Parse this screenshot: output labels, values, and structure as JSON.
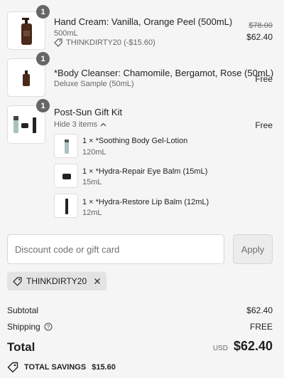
{
  "items": [
    {
      "quantity": "1",
      "name": "Hand Cream: Vanilla, Orange Peel (500mL)",
      "variant": "500mL",
      "discount_code": "THINKDIRTY20 (-$15.60)",
      "original_price": "$78.00",
      "price": "$62.40"
    },
    {
      "quantity": "1",
      "name": "*Body Cleanser: Chamomile, Bergamot, Rose (50mL)",
      "variant": "Deluxe Sample (50mL)",
      "price": "Free"
    },
    {
      "quantity": "1",
      "name": "Post-Sun Gift Kit",
      "toggle_label": "Hide 3 items",
      "price": "Free",
      "components": [
        {
          "name": "1 × *Soothing Body Gel-Lotion",
          "size": "120mL"
        },
        {
          "name": "1 × *Hydra-Repair Eye Balm (15mL)",
          "size": "15mL"
        },
        {
          "name": "1 × *Hydra-Restore Lip Balm (12mL)",
          "size": "12mL"
        }
      ]
    }
  ],
  "discount": {
    "placeholder": "Discount code or gift card",
    "apply_label": "Apply",
    "applied_code": "THINKDIRTY20"
  },
  "summary": {
    "subtotal_label": "Subtotal",
    "subtotal_value": "$62.40",
    "shipping_label": "Shipping",
    "shipping_value": "FREE",
    "total_label": "Total",
    "currency": "USD",
    "total_value": "$62.40",
    "savings_label": "TOTAL SAVINGS",
    "savings_value": "$15.60"
  }
}
